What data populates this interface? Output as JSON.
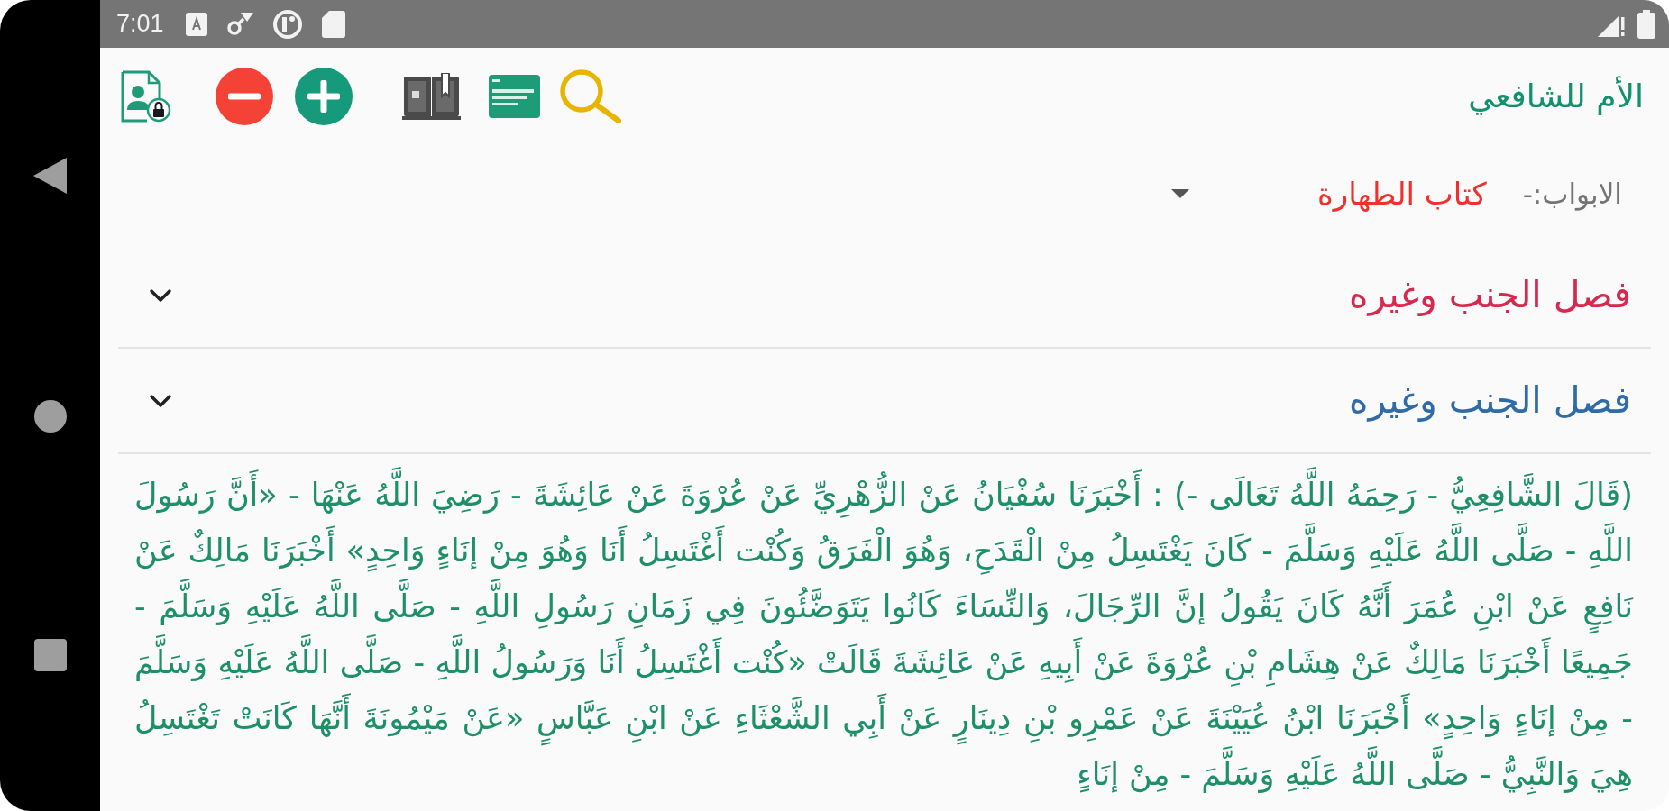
{
  "status_bar": {
    "time": "7:01"
  },
  "toolbar": {
    "title": "الأم للشافعي"
  },
  "chapter_picker": {
    "label": "الابواب:-",
    "value": "كتاب الطهارة"
  },
  "sections": [
    {
      "title": "فصل الجنب وغيره",
      "color": "#d6294f"
    },
    {
      "title": "فصل الجنب وغيره",
      "color": "#2f6ba8"
    }
  ],
  "body_text": "(قَالَ الشَّافِعِيُّ - رَحِمَهُ اللَّهُ تَعَالَى -) : أَخْبَرَنَا سُفْيَانُ عَنْ الزُّهْرِيِّ عَنْ عُرْوَةَ عَنْ عَائِشَةَ - رَضِيَ اللَّهُ عَنْهَا - «أَنَّ رَسُولَ اللَّهِ - صَلَّى اللَّهُ عَلَيْهِ وَسَلَّمَ - كَانَ يَغْتَسِلُ مِنْ الْقَدَحِ، وَهُوَ الْفَرَقُ وَكُنْت أَغْتَسِلُ أَنَا وَهُوَ مِنْ إنَاءٍ وَاحِدٍ» أَخْبَرَنَا مَالِكٌ عَنْ نَافِعٍ عَنْ ابْنِ عُمَرَ أَنَّهُ كَانَ يَقُولُ إنَّ الرِّجَالَ، وَالنِّسَاءَ كَانُوا يَتَوَضَّئُونَ فِي زَمَانِ رَسُولِ اللَّهِ - صَلَّى اللَّهُ عَلَيْهِ وَسَلَّمَ - جَمِيعًا أَخْبَرَنَا مَالِكٌ عَنْ هِشَامِ بْنِ عُرْوَةَ عَنْ أَبِيهِ عَنْ عَائِشَةَ قَالَتْ «كُنْت أَغْتَسِلُ أَنَا وَرَسُولُ اللَّهِ - صَلَّى اللَّهُ عَلَيْهِ وَسَلَّمَ - مِنْ إنَاءٍ وَاحِدٍ» أَخْبَرَنَا ابْنُ عُيَيْنَةَ عَنْ عَمْرِو بْنِ دِينَارٍ عَنْ أَبِي الشَّعْثَاءِ عَنْ ابْنِ عَبَّاسٍ «عَنْ مَيْمُونَةَ أَنَّهَا كَانَتْ تَغْتَسِلُ هِيَ وَالنَّبِيُّ - صَلَّى اللَّهُ عَلَيْهِ وَسَلَّمَ - مِنْ إنَاءٍ"
}
